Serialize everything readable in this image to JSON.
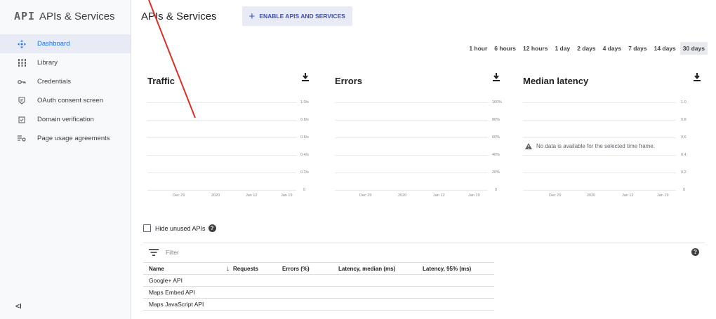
{
  "sidebar": {
    "logo": "API",
    "title": "APIs & Services",
    "items": [
      {
        "label": "Dashboard",
        "icon": "dashboard-icon",
        "active": true
      },
      {
        "label": "Library",
        "icon": "library-icon"
      },
      {
        "label": "Credentials",
        "icon": "key-icon"
      },
      {
        "label": "OAuth consent screen",
        "icon": "consent-icon"
      },
      {
        "label": "Domain verification",
        "icon": "domain-icon"
      },
      {
        "label": "Page usage agreements",
        "icon": "agreements-icon"
      }
    ],
    "collapse_label": "<I"
  },
  "header": {
    "title": "APIs & Services",
    "enable_button": "ENABLE APIS AND SERVICES"
  },
  "time_range": {
    "options": [
      "1 hour",
      "6 hours",
      "12 hours",
      "1 day",
      "2 days",
      "4 days",
      "7 days",
      "14 days",
      "30 days"
    ],
    "selected": "30 days"
  },
  "charts": {
    "traffic": {
      "title": "Traffic",
      "y_ticks": [
        "1.0/s",
        "0.8/s",
        "0.6/s",
        "0.4/s",
        "0.2/s",
        "0"
      ],
      "x_ticks": [
        "Dec 29",
        "2020",
        "Jan 12",
        "Jan 19"
      ]
    },
    "errors": {
      "title": "Errors",
      "y_ticks": [
        "100%",
        "80%",
        "60%",
        "40%",
        "20%",
        "0"
      ],
      "x_ticks": [
        "Dec 29",
        "2020",
        "Jan 12",
        "Jan 19"
      ]
    },
    "latency": {
      "title": "Median latency",
      "y_ticks": [
        "1.0",
        "0.8",
        "0.6",
        "0.4",
        "0.2",
        "0"
      ],
      "x_ticks": [
        "Dec 29",
        "2020",
        "Jan 12",
        "Jan 19"
      ],
      "no_data": "No data is available for the selected time frame."
    }
  },
  "hide_unused": {
    "label": "Hide unused APIs",
    "checked": false
  },
  "filter": {
    "placeholder": "Filter"
  },
  "table": {
    "columns": [
      "Name",
      "Requests",
      "Errors (%)",
      "Latency, median (ms)",
      "Latency, 95% (ms)"
    ],
    "sort_column": "Requests",
    "rows": [
      {
        "name": "Google+ API"
      },
      {
        "name": "Maps Embed API"
      },
      {
        "name": "Maps JavaScript API"
      }
    ]
  },
  "colors": {
    "accent": "#1a73e8",
    "button_bg": "#e8eaf6",
    "button_text": "#3f51b5",
    "annotation": "#d93025"
  }
}
